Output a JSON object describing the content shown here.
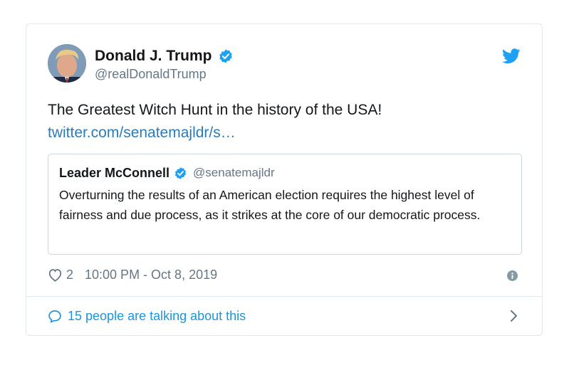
{
  "tweet": {
    "author_name": "Donald J. Trump",
    "author_handle": "@realDonaldTrump",
    "text": "The Greatest Witch Hunt in the history of the USA!",
    "link": "twitter.com/senatemajldr/s…",
    "like_count": "2",
    "timestamp": "10:00 PM - Oct 8, 2019",
    "talking_text": "15 people are talking about this"
  },
  "quoted": {
    "author_name": "Leader McConnell",
    "author_handle": "@senatemajldr",
    "text": "Overturning the results of an American election requires the highest level of fairness and due process, as it strikes at the core of our democratic process."
  },
  "icons": {
    "brand": "twitter-bird-icon",
    "verified": "verified-badge-icon",
    "like": "heart-icon",
    "info": "info-icon",
    "reply": "speech-bubble-icon",
    "navigate": "chevron-right-icon"
  },
  "colors": {
    "link": "#2b7bb9",
    "brand_blue": "#1da1f2",
    "secondary_text": "#657786",
    "border": "#e1e8ed"
  }
}
